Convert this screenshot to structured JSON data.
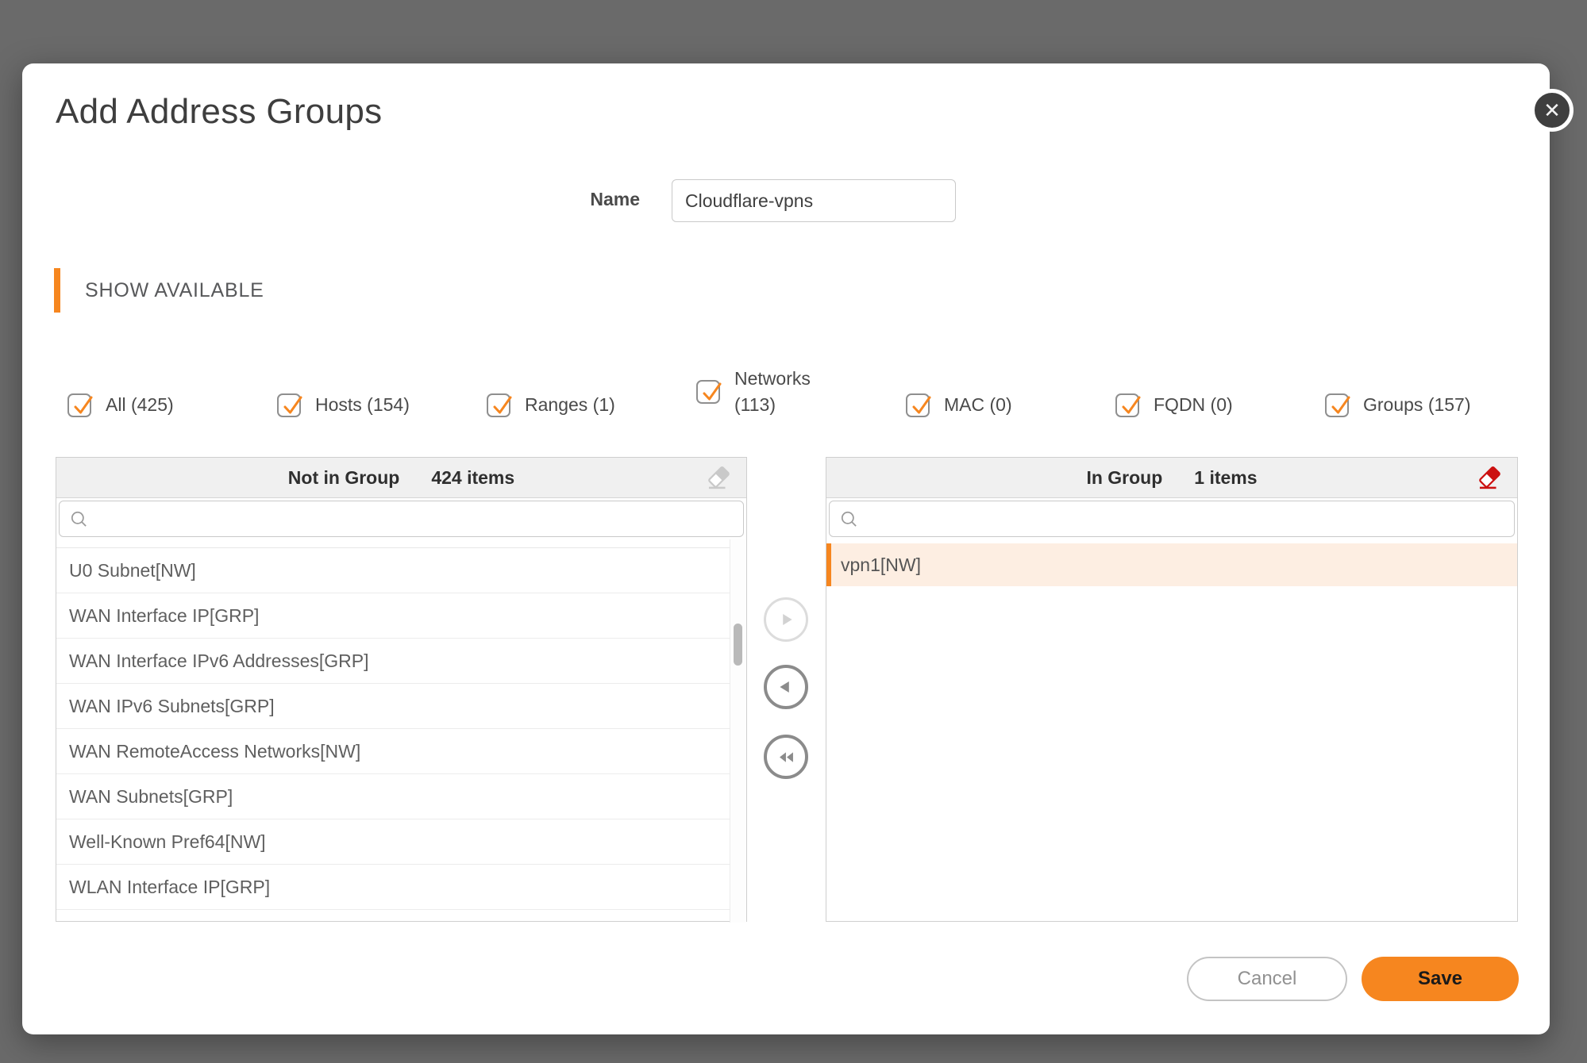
{
  "modal": {
    "title": "Add Address Groups"
  },
  "icons": {
    "close": "✕"
  },
  "name_field": {
    "label": "Name",
    "value": "Cloudflare-vpns"
  },
  "section": {
    "heading": "SHOW AVAILABLE"
  },
  "filters": {
    "items": [
      {
        "label": "All (425)",
        "checked": true
      },
      {
        "label": "Hosts (154)",
        "checked": true
      },
      {
        "label": "Ranges (1)",
        "checked": true
      },
      {
        "label": "Networks (113)",
        "checked": true
      },
      {
        "label": "MAC (0)",
        "checked": true
      },
      {
        "label": "FQDN (0)",
        "checked": true
      },
      {
        "label": "Groups (157)",
        "checked": true
      }
    ]
  },
  "left_panel": {
    "title": "Not in Group",
    "count": "424 items",
    "search_value": "",
    "items": [
      "U0 Subnet[NW]",
      "WAN Interface IP[GRP]",
      "WAN Interface IPv6 Addresses[GRP]",
      "WAN IPv6 Subnets[GRP]",
      "WAN RemoteAccess Networks[NW]",
      "WAN Subnets[GRP]",
      "Well-Known Pref64[NW]",
      "WLAN Interface IP[GRP]"
    ]
  },
  "right_panel": {
    "title": "In Group",
    "count": "1 items",
    "search_value": "",
    "items": [
      "vpn1[NW]"
    ]
  },
  "footer": {
    "cancel_label": "Cancel",
    "save_label": "Save"
  },
  "colors": {
    "accent": "#f6861f",
    "eraser_active": "#cc1111",
    "eraser_disabled": "#c9c9c9",
    "overlay": "#6a6a6a"
  }
}
